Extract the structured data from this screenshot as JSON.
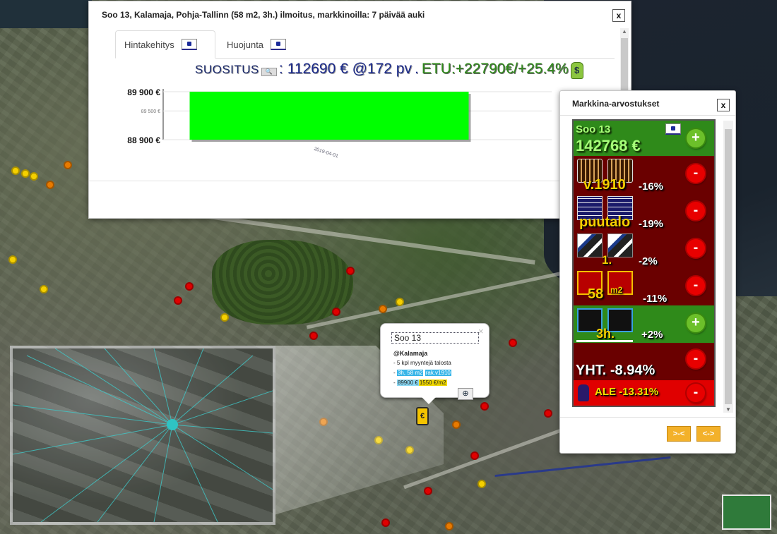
{
  "listing_dialog": {
    "title": "Soo 13, Kalamaja, Pohja-Tallinn (58 m2, 3h.) ilmoitus, markkinoilla: 7 päivää auki",
    "close_label": "x",
    "tabs": [
      {
        "label": "Hintakehitys",
        "active": true
      },
      {
        "label": "Huojunta",
        "active": false
      }
    ],
    "suositus": {
      "label": "SUOSITUS",
      "button": "🔍",
      "separator": ":",
      "price": "112690 € @172 pv",
      "dot": ".",
      "etu": "ETU:+22790€/+25.4%",
      "icon": "money-bag-icon"
    }
  },
  "chart_data": {
    "type": "bar",
    "categories": [
      "2019-04-01"
    ],
    "values": [
      89900
    ],
    "value_floor": 88900,
    "ytick_labels": [
      "89 900 €",
      "89 500 €",
      "88 900 €"
    ],
    "ylim": [
      88900,
      89900
    ],
    "bar_color": "#00ff00",
    "grid": true,
    "title": "",
    "xlabel": "",
    "ylabel": ""
  },
  "market_dialog": {
    "title": "Markkina-arvostukset",
    "close_label": "x",
    "header": {
      "name": "Soo 13",
      "value": "142768 €",
      "button": "+"
    },
    "rows": [
      {
        "icon": "calendar-icon",
        "label": "v.1910",
        "pct": "-16%",
        "button": "-",
        "bg": "dark"
      },
      {
        "icon": "brick-wall-icon",
        "label": "puutalo",
        "pct": "-19%",
        "button": "-",
        "bg": "dark"
      },
      {
        "icon": "stairs-icon",
        "label": "1.",
        "pct": "-2%",
        "button": "-",
        "bg": "dark"
      },
      {
        "icon": "floorplan-icon",
        "label": "58",
        "sublabel": "m2",
        "pct": "-11%",
        "button": "-",
        "bg": "dark"
      },
      {
        "icon": "rooms-icon",
        "label": "3h.",
        "pct": "+2%",
        "button": "+",
        "bg": "green"
      }
    ],
    "total": {
      "label": "YHT. -8.94%",
      "button": "-"
    },
    "ale": {
      "label": "ALE -13.31%",
      "button": "-",
      "icon": "hand-icon"
    },
    "nav_buttons": [
      ">-<",
      "<->"
    ]
  },
  "popup": {
    "title": "Soo 13",
    "close_label": "×",
    "area": "@Kalamaja",
    "line1": "- 5 kpl myyntejä talosta",
    "line2_prefix": "- ",
    "line2_a": "3h, 58 m2",
    "line2_b": "rak.v1910",
    "line3_prefix": "- ",
    "line3_a": "89900 €",
    "line3_b": "1550 €/m2",
    "zoom_icon": "zoom-in-icon"
  },
  "map": {
    "poi_marker": "€",
    "marker_colors": [
      "#f5d000",
      "#e87a00",
      "#e00000"
    ]
  }
}
